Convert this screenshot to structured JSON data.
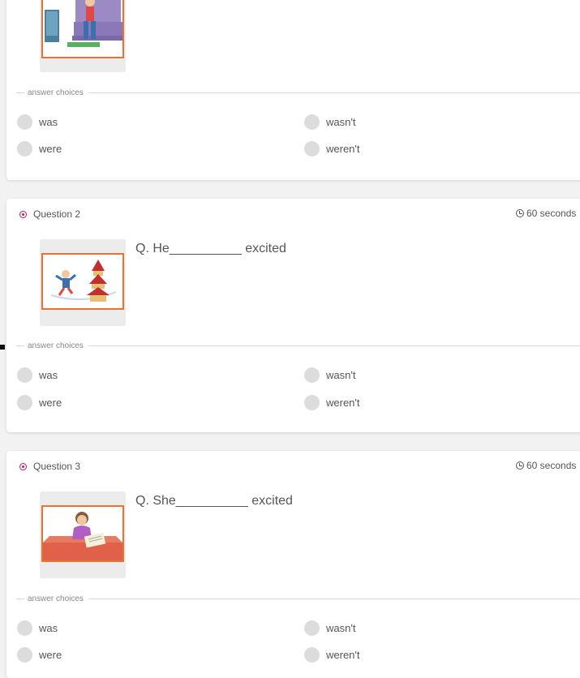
{
  "answer_choices_label": "answer choices",
  "questions": [
    {
      "options": [
        "was",
        "wasn't",
        "were",
        "weren't"
      ]
    },
    {
      "number_label": "Question 2",
      "timer": "60 seconds",
      "text": "Q. He__________ excited",
      "options": [
        "was",
        "wasn't",
        "were",
        "weren't"
      ]
    },
    {
      "number_label": "Question 3",
      "timer": "60 seconds",
      "text": "Q. She__________ excited",
      "options": [
        "was",
        "wasn't",
        "were",
        "weren't"
      ]
    }
  ],
  "colors": {
    "accent": "#c2185b",
    "image_border": "#e9722e",
    "radio": "#dcdcdc"
  }
}
